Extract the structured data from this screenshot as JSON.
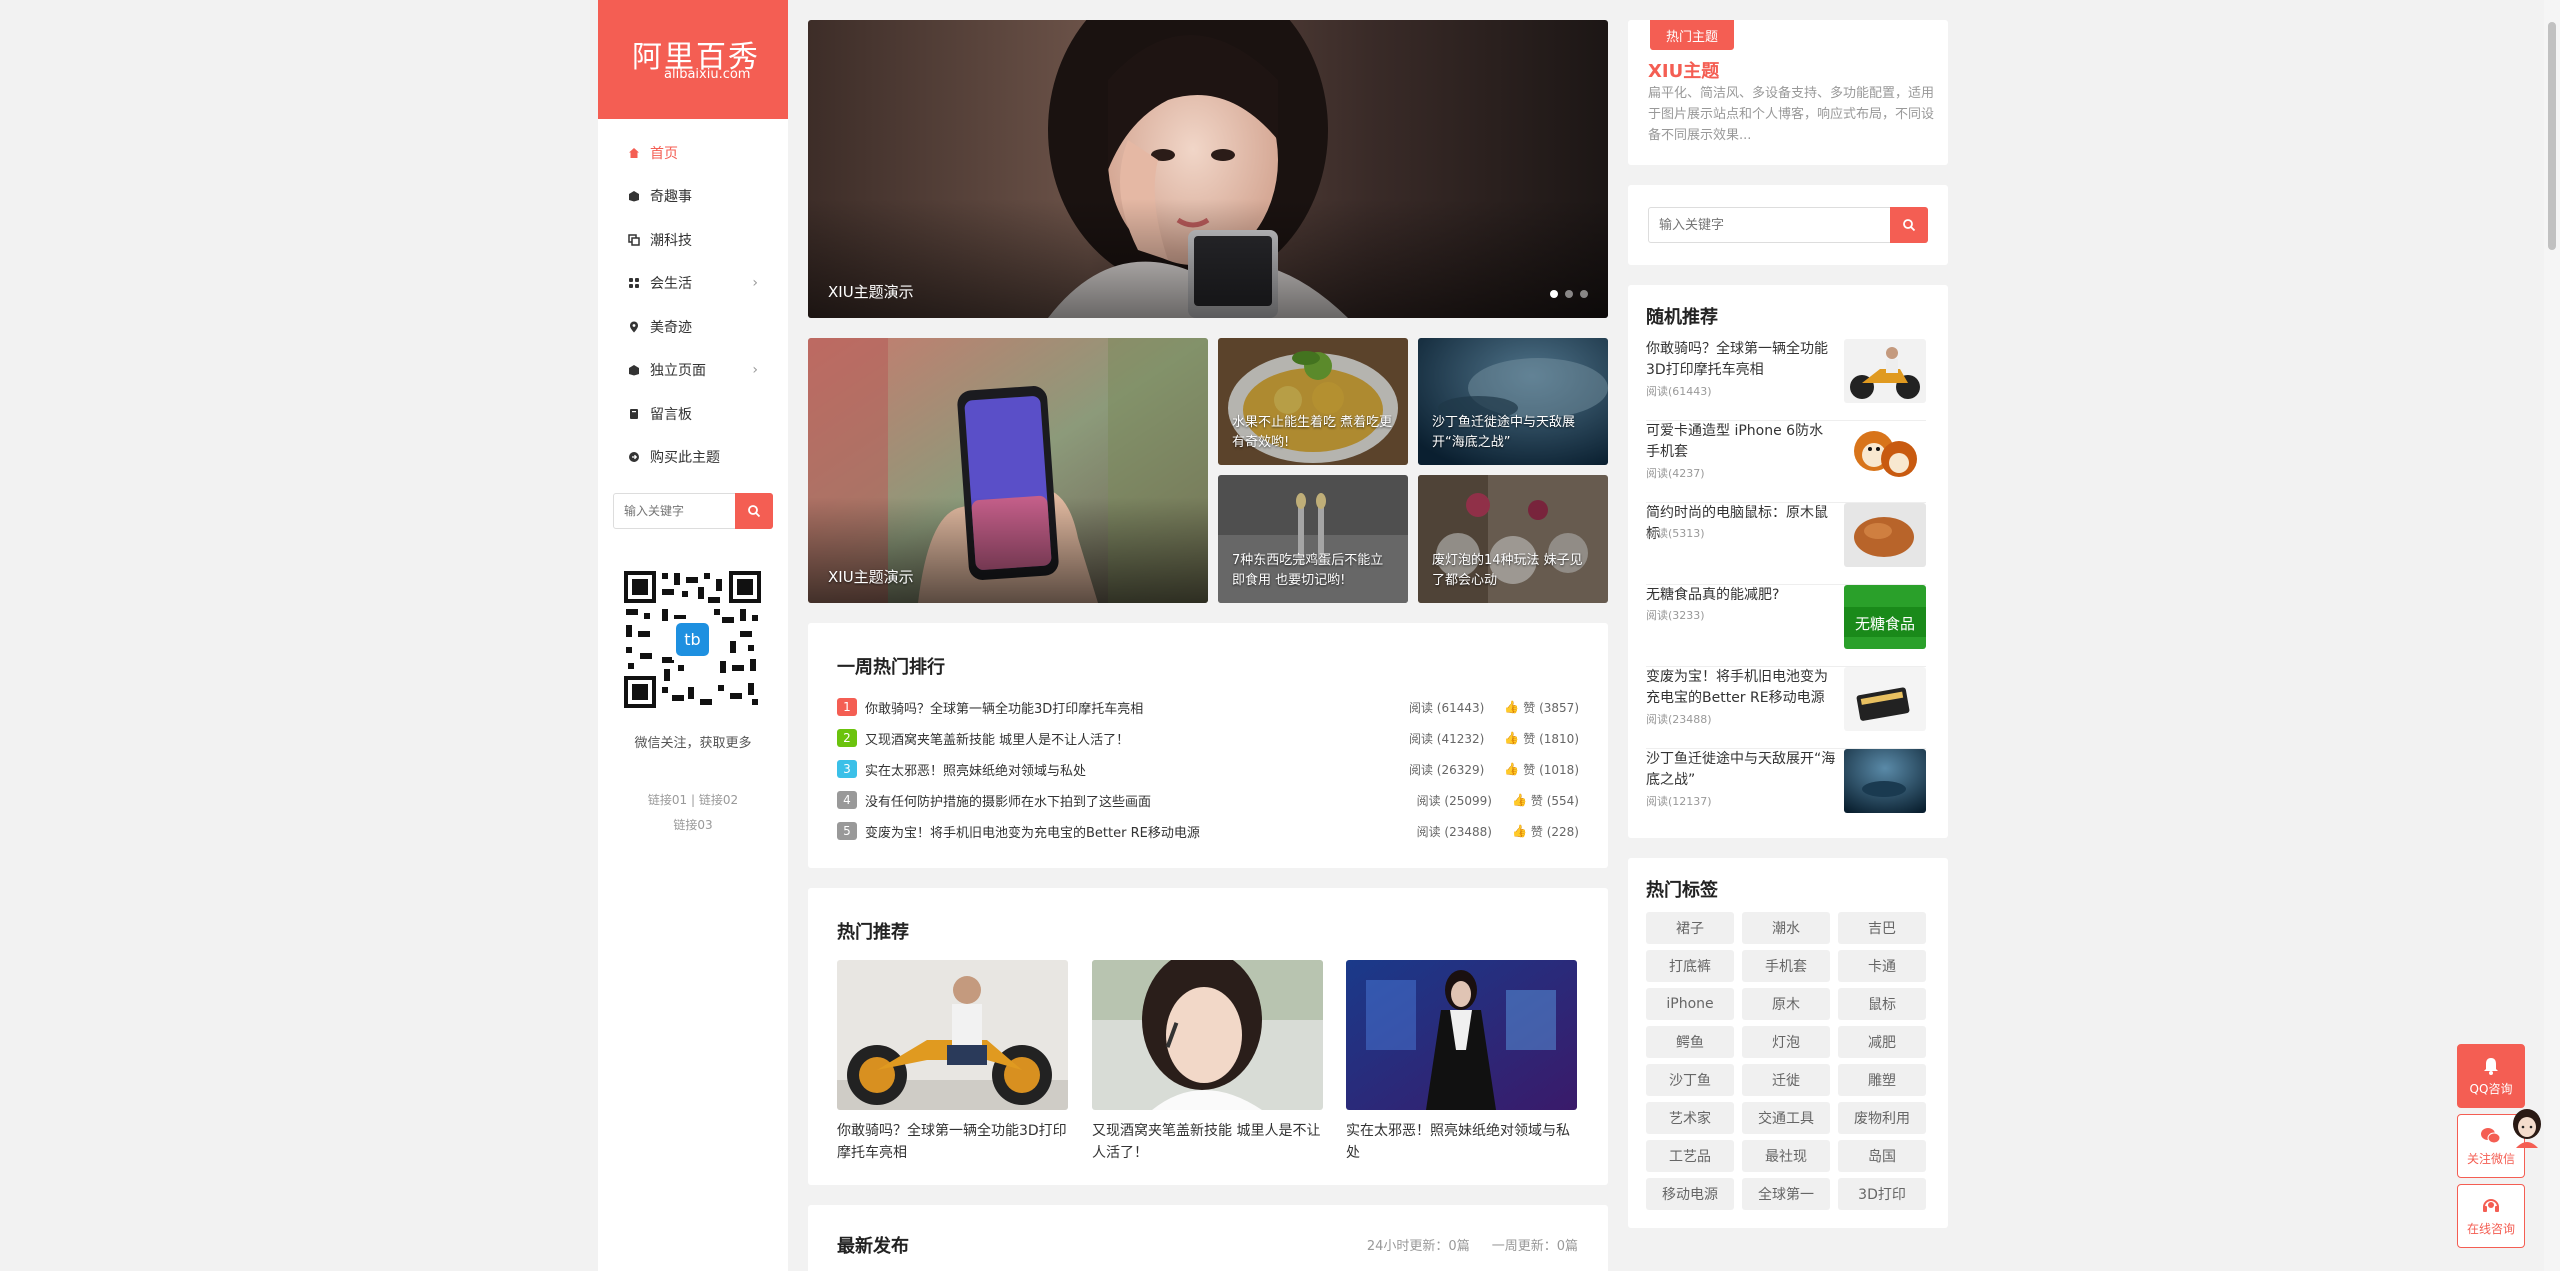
{
  "logo": {
    "main": "阿里百秀",
    "sub": "alibaixiu.com"
  },
  "nav": [
    {
      "label": "首页",
      "icon": "home-icon"
    },
    {
      "label": "奇趣事",
      "icon": "box-icon"
    },
    {
      "label": "潮科技",
      "icon": "copy-icon"
    },
    {
      "label": "会生活",
      "icon": "grid-icon",
      "has_arrow": true
    },
    {
      "label": "美奇迹",
      "icon": "pin-icon"
    },
    {
      "label": "独立页面",
      "icon": "box-icon",
      "has_arrow": true
    },
    {
      "label": "留言板",
      "icon": "book-icon"
    },
    {
      "label": "购买此主题",
      "icon": "circle-arrow-icon"
    }
  ],
  "side_search": {
    "placeholder": "输入关键字"
  },
  "qr_caption": "微信关注，获取更多",
  "side_links": {
    "line1": "链接01 | 链接02",
    "line2": "链接03"
  },
  "slider": {
    "caption": "XIU主题演示",
    "slides": 3,
    "active": 1
  },
  "tiles": {
    "big": "XIU主题演示",
    "t1": "水果不止能生着吃 煮着吃更有奇效哟!",
    "t2": "沙丁鱼迁徙途中与天敌展开“海底之战”",
    "t3": "7种东西吃完鸡蛋后不能立即食用 也要切记哟!",
    "t4": "废灯泡的14种玩法 妹子见了都会心动"
  },
  "weekly": {
    "title": "一周热门排行",
    "rows": [
      {
        "num": "1",
        "title": "你敢骑吗？全球第一辆全功能3D打印摩托车亮相",
        "read": "阅读 (61443)",
        "like": "赞 (3857)",
        "color": "#f45e53"
      },
      {
        "num": "2",
        "title": "又现酒窝夹笔盖新技能 城里人是不让人活了！",
        "read": "阅读 (41232)",
        "like": "赞 (1810)",
        "color": "#6bc30d"
      },
      {
        "num": "3",
        "title": "实在太邪恶！照亮妹纸绝对领域与私处",
        "read": "阅读 (26329)",
        "like": "赞 (1018)",
        "color": "#3bc0e8"
      },
      {
        "num": "4",
        "title": "没有任何防护措施的摄影师在水下拍到了这些画面",
        "read": "阅读 (25099)",
        "like": "赞 (554)",
        "color": "#999999"
      },
      {
        "num": "5",
        "title": "变废为宝！将手机旧电池变为充电宝的Better RE移动电源",
        "read": "阅读 (23488)",
        "like": "赞 (228)",
        "color": "#999999"
      }
    ]
  },
  "hot_rec": {
    "title": "热门推荐",
    "items": [
      "你敢骑吗？全球第一辆全功能3D打印摩托车亮相",
      "又现酒窝夹笔盖新技能 城里人是不让人活了！",
      "实在太邪恶！照亮妹纸绝对领域与私处"
    ]
  },
  "latest": {
    "title": "最新发布",
    "stat1": "24小时更新：0篇",
    "stat2": "一周更新：0篇"
  },
  "theme_widget": {
    "badge": "热门主题",
    "name": "XIU主题",
    "desc": "扁平化、简洁风、多设备支持、多功能配置，适用于图片展示站点和个人博客，响应式布局，不同设备不同展示效果..."
  },
  "right_search": {
    "placeholder": "输入关键字"
  },
  "random": {
    "title": "随机推荐",
    "items": [
      {
        "title": "你敢骑吗？全球第一辆全功能3D打印摩托车亮相",
        "read": "阅读(61443)"
      },
      {
        "title": "可爱卡通造型 iPhone 6防水手机套",
        "read": "阅读(4237)"
      },
      {
        "title": "简约时尚的电脑鼠标：原木鼠标",
        "read": "阅读(5313)"
      },
      {
        "title": "无糖食品真的能减肥?",
        "read": "阅读(3233)"
      },
      {
        "title": "变废为宝！将手机旧电池变为充电宝的Better RE移动电源",
        "read": "阅读(23488)"
      },
      {
        "title": "沙丁鱼迁徙途中与天敌展开“海底之战”",
        "read": "阅读(12137)"
      }
    ],
    "thumb_labels": {
      "sugar": "无糖食品"
    }
  },
  "tags": {
    "title": "热门标签",
    "items": [
      "裙子",
      "潮水",
      "吉巴",
      "打底裤",
      "手机套",
      "卡通",
      "iPhone",
      "原木",
      "鼠标",
      "鳄鱼",
      "灯泡",
      "减肥",
      "沙丁鱼",
      "迁徙",
      "雕塑",
      "艺术家",
      "交通工具",
      "废物利用",
      "工艺品",
      "最社现",
      "岛国",
      "移动电源",
      "全球第一",
      "3D打印"
    ]
  },
  "float": {
    "qq": "QQ咨询",
    "wechat": "关注微信",
    "online": "在线咨询"
  },
  "colors": {
    "accent": "#f45e53"
  }
}
